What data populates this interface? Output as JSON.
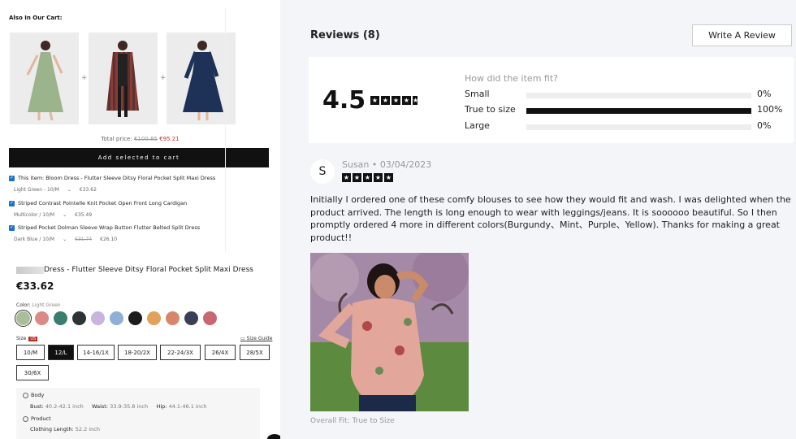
{
  "cart_section": {
    "title": "Also In Our Cart:",
    "total_label": "Total price:",
    "total_original": "€100.85",
    "total_sale": "€95.21",
    "add_button": "Add selected to cart",
    "items": [
      {
        "name": "This item: Bloom Dress - Flutter Sleeve Ditsy Floral Pocket Split Maxi Dress",
        "variant": "Light Green - 10/M",
        "price_original": "",
        "price": "€33.62",
        "checked": true
      },
      {
        "name": "Striped Contrast Pointelle Knit Pocket Open Front Long Cardigan",
        "variant": "Multicolor / 10/M",
        "price_original": "",
        "price": "€35.49",
        "checked": true
      },
      {
        "name": "Striped Pocket Dolman Sleeve Wrap Button Flutter Belted Split Dress",
        "variant": "Dark Blue / 10/M",
        "price_original": "€31.74",
        "price": "€26.10",
        "checked": true
      }
    ]
  },
  "product": {
    "name": "Dress - Flutter Sleeve Ditsy Floral Pocket Split Maxi Dress",
    "price": "€33.62",
    "color_label": "Color:",
    "color_value": "Light Green",
    "swatch_colors": [
      "#a9bf9a",
      "#d98b86",
      "#3a7d6e",
      "#2f3333",
      "#c8b4de",
      "#8fb0d6",
      "#1c1c1c",
      "#e0a25a",
      "#d8866b",
      "#3a3f58",
      "#c96770"
    ],
    "size_label": "Size",
    "size_region": "US",
    "size_guide": "Size Guide",
    "sizes": [
      "10/M",
      "12/L",
      "14-16/1X",
      "18-20/2X",
      "22-24/3X",
      "26/4X",
      "28/5X",
      "30/6X"
    ],
    "selected_size": "12/L",
    "body_title": "Body",
    "bust_label": "Bust:",
    "bust_value": "40.2-42.1 inch",
    "waist_label": "Waist:",
    "waist_value": "33.9-35.8 inch",
    "hip_label": "Hip:",
    "hip_value": "44.1-46.1 inch",
    "product_title": "Product",
    "length_label": "Clothing Length:",
    "length_value": "52.2 inch"
  },
  "reviews": {
    "title": "Reviews (8)",
    "write_button": "Write A Review",
    "average": "4.5",
    "fit_question": "How did the item fit?",
    "fit": [
      {
        "label": "Small",
        "percent": 0,
        "text": "0%"
      },
      {
        "label": "True to size",
        "percent": 100,
        "text": "100%"
      },
      {
        "label": "Large",
        "percent": 0,
        "text": "0%"
      }
    ],
    "review": {
      "initial": "S",
      "author": "Susan",
      "separator": "•",
      "date": "03/04/2023",
      "text": "Initially I ordered one of these comfy blouses to see how they would fit and wash. I was delighted when the product arrived. The length is long enough to wear with leggings/jeans. It is soooooo beautiful. So I then promptly ordered 4 more in different colors(Burgundy、Mint、Purple、Yellow). Thanks for making a great product!!",
      "overall_fit": "Overall Fit: True to Size"
    }
  }
}
